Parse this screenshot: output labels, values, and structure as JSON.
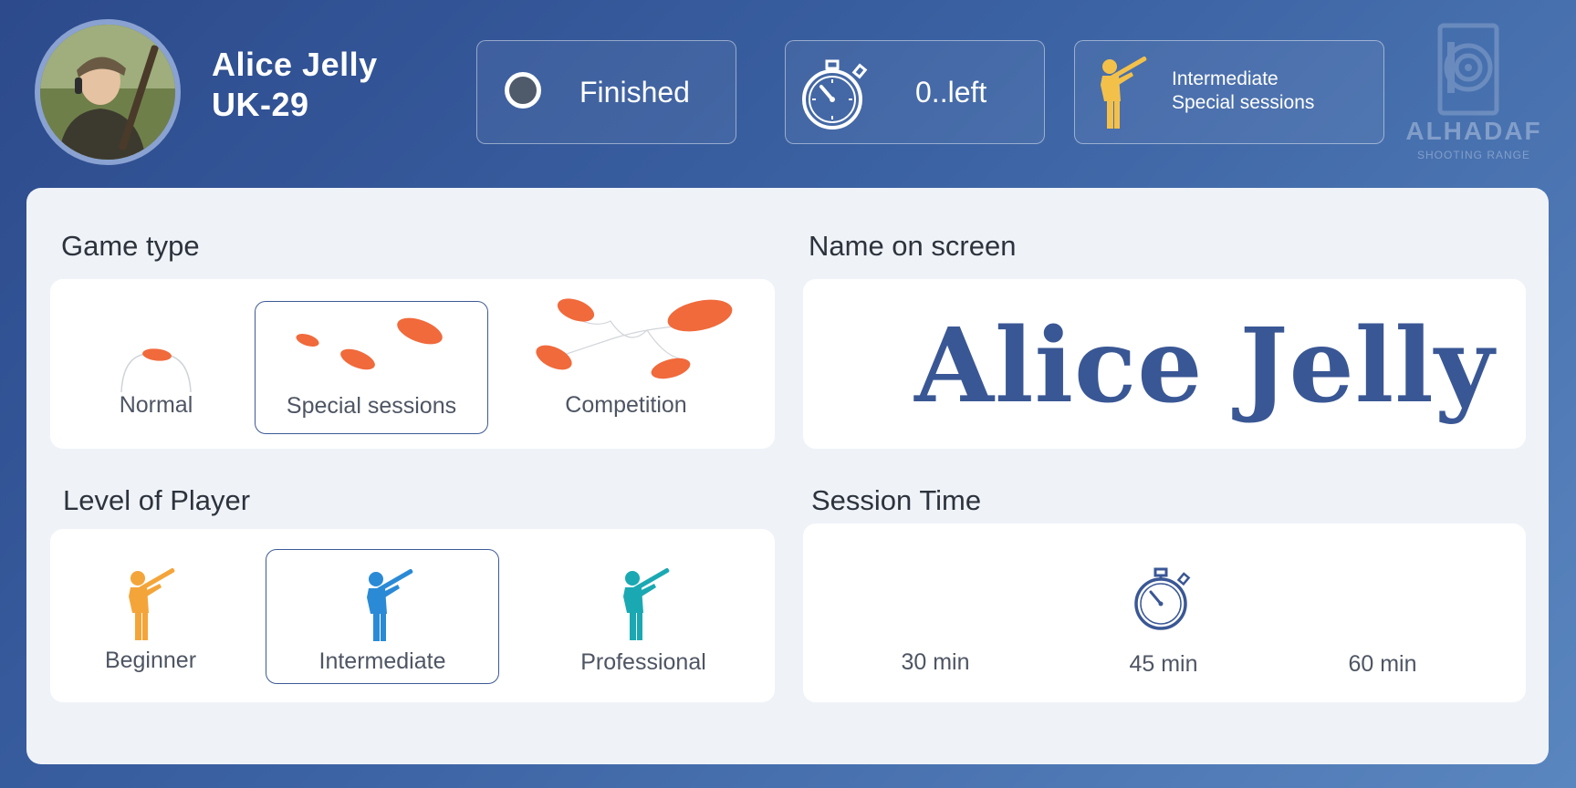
{
  "player": {
    "name": "Alice Jelly",
    "id": "UK-29"
  },
  "status": {
    "label": "Finished",
    "dot_color": "#4f5a6b"
  },
  "timer": {
    "label": "0..left",
    "icon": "stopwatch-icon"
  },
  "current_level": {
    "line1": "Intermediate",
    "line2": "Special sessions",
    "icon": "shooter-icon",
    "icon_color": "#f3c14a"
  },
  "brand": {
    "name": "ALHADAF",
    "subtitle": "SHOOTING RANGE"
  },
  "game_type": {
    "title": "Game type",
    "options": [
      {
        "label": "Normal",
        "selected": false
      },
      {
        "label": "Special sessions",
        "selected": true
      },
      {
        "label": "Competition",
        "selected": false
      }
    ],
    "accent": "#f06a3c"
  },
  "name_on_screen": {
    "title": "Name on screen",
    "value": "Alice Jelly"
  },
  "player_level": {
    "title": "Level of Player",
    "options": [
      {
        "label": "Beginner",
        "selected": false,
        "color": "#f4a53a"
      },
      {
        "label": "Intermediate",
        "selected": true,
        "color": "#2b8ad6"
      },
      {
        "label": "Professional",
        "selected": false,
        "color": "#1aa9b3"
      }
    ]
  },
  "session_time": {
    "title": "Session Time",
    "options": [
      {
        "label": "30 min",
        "selected": false
      },
      {
        "label": "45 min",
        "selected": true
      },
      {
        "label": "60 min",
        "selected": false
      }
    ]
  }
}
